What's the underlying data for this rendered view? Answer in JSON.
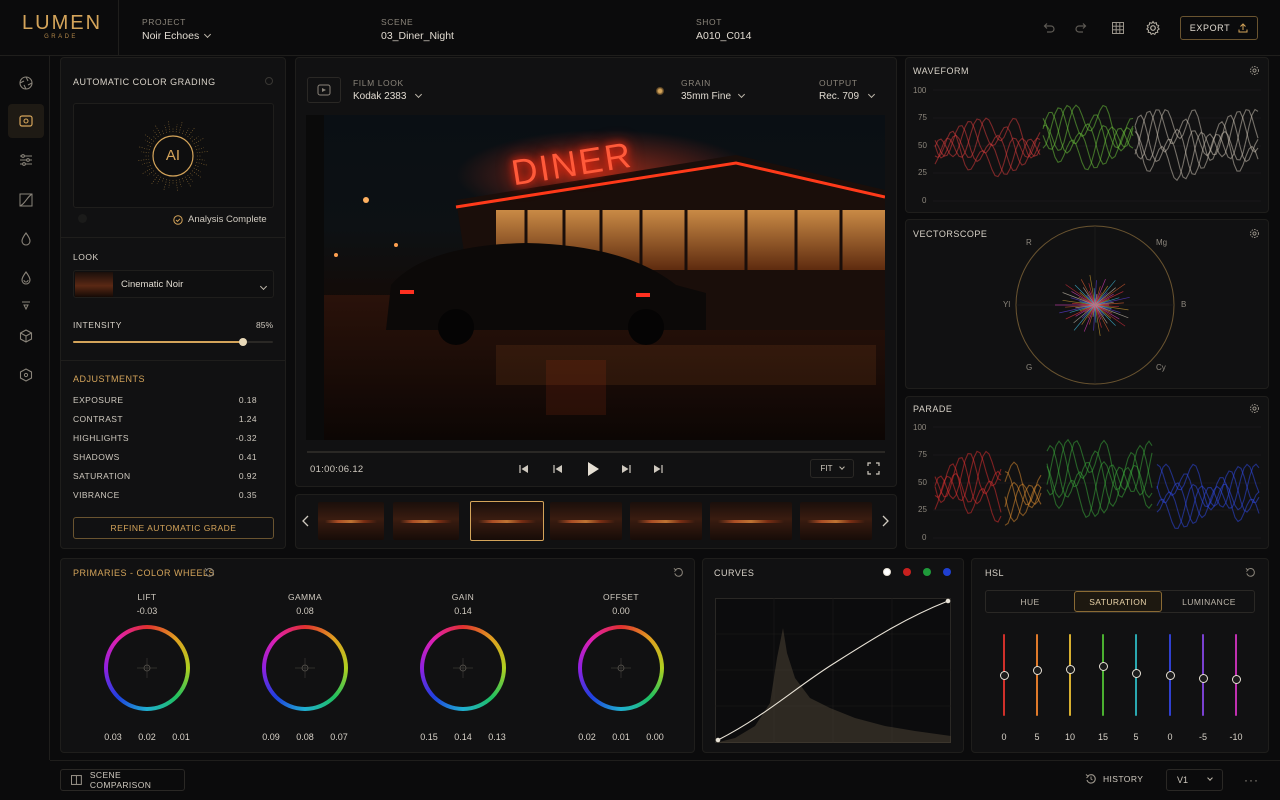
{
  "app": {
    "logo": "LUMEN",
    "logo_sub": "GRADE"
  },
  "topbar": {
    "project_label": "PROJECT",
    "project_value": "Noir Echoes",
    "scene_label": "SCENE",
    "scene_value": "03_Diner_Night",
    "shot_label": "SHOT",
    "shot_value": "A010_C014",
    "export_label": "EXPORT"
  },
  "auto_grade": {
    "title": "AUTOMATIC COLOR GRADING",
    "ai_badge": "AI",
    "status": "Analysis Complete",
    "look_label": "LOOK",
    "look_value": "Cinematic Noir",
    "intensity_label": "INTENSITY",
    "intensity_value": "85%",
    "intensity_fraction": 0.85,
    "adjustments_label": "ADJUSTMENTS",
    "adjustments": [
      {
        "name": "EXPOSURE",
        "value": "0.18"
      },
      {
        "name": "CONTRAST",
        "value": "1.24"
      },
      {
        "name": "HIGHLIGHTS",
        "value": "-0.32"
      },
      {
        "name": "SHADOWS",
        "value": "0.41"
      },
      {
        "name": "SATURATION",
        "value": "0.92"
      },
      {
        "name": "VIBRANCE",
        "value": "0.35"
      }
    ],
    "refine_button": "REFINE AUTOMATIC GRADE"
  },
  "viewer": {
    "film_look_label": "FILM LOOK",
    "film_look_value": "Kodak 2383",
    "grain_label": "GRAIN",
    "grain_value": "35mm Fine",
    "output_label": "OUTPUT",
    "output_value": "Rec. 709",
    "sign_text": "DINER",
    "timecode": "01:00:06.12",
    "fit_label": "FIT"
  },
  "scopes": {
    "waveform_title": "WAVEFORM",
    "vectorscope_title": "VECTORSCOPE",
    "parade_title": "PARADE",
    "y_ticks": [
      "100",
      "75",
      "50",
      "25",
      "0"
    ],
    "vector_labels": {
      "r": "R",
      "mg": "Mg",
      "b": "B",
      "cy": "Cy",
      "g": "G",
      "yl": "Yl"
    }
  },
  "primaries": {
    "title": "PRIMARIES - COLOR WHEELS",
    "wheels": [
      {
        "name": "LIFT",
        "value": "-0.03",
        "rgb": [
          "0.03",
          "0.02",
          "0.01"
        ]
      },
      {
        "name": "GAMMA",
        "value": "0.08",
        "rgb": [
          "0.09",
          "0.08",
          "0.07"
        ]
      },
      {
        "name": "GAIN",
        "value": "0.14",
        "rgb": [
          "0.15",
          "0.14",
          "0.13"
        ]
      },
      {
        "name": "OFFSET",
        "value": "0.00",
        "rgb": [
          "0.02",
          "0.01",
          "0.00"
        ]
      }
    ]
  },
  "curves": {
    "title": "CURVES",
    "channel_colors": [
      "#e8e2d6",
      "#c8201e",
      "#1f9a3a",
      "#1f3fd0"
    ]
  },
  "hsl": {
    "title": "HSL",
    "tabs": [
      "HUE",
      "SATURATION",
      "LUMINANCE"
    ],
    "active_tab": "SATURATION",
    "sliders": [
      {
        "color": "#d0302a",
        "value": "0",
        "level": 0.5
      },
      {
        "color": "#e07a2a",
        "value": "5",
        "level": 0.55
      },
      {
        "color": "#d8b030",
        "value": "10",
        "level": 0.57
      },
      {
        "color": "#4ab030",
        "value": "15",
        "level": 0.6
      },
      {
        "color": "#2aa8b0",
        "value": "5",
        "level": 0.52
      },
      {
        "color": "#3040d0",
        "value": "0",
        "level": 0.5
      },
      {
        "color": "#7a40d0",
        "value": "-5",
        "level": 0.46
      },
      {
        "color": "#c030b0",
        "value": "-10",
        "level": 0.45
      }
    ]
  },
  "bottombar": {
    "scene_comparison": "SCENE COMPARISON",
    "history": "HISTORY",
    "version": "V1"
  },
  "colors": {
    "accent": "#d4a45a",
    "background": "#0b0b0c",
    "panel": "#111112"
  }
}
